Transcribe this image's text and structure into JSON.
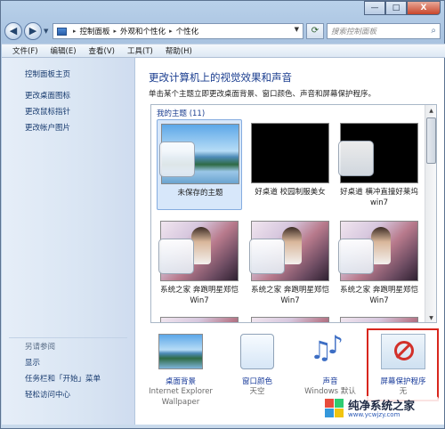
{
  "window": {
    "minimize": "—",
    "maximize": "□",
    "close": "X"
  },
  "nav": {
    "back_glyph": "◀",
    "forward_glyph": "▶",
    "dropdown_glyph": "▼",
    "breadcrumbs": [
      "控制面板",
      "外观和个性化",
      "个性化"
    ],
    "refresh_glyph": "⟳",
    "search_placeholder": "搜索控制面板",
    "search_icon": "search-icon"
  },
  "menu": [
    "文件(F)",
    "编辑(E)",
    "查看(V)",
    "工具(T)",
    "帮助(H)"
  ],
  "left_pane": {
    "links": [
      "控制面板主页",
      "更改桌面图标",
      "更改鼠标指针",
      "更改帐户图片"
    ],
    "see_also_header": "另请参阅",
    "see_also": [
      "显示",
      "任务栏和「开始」菜单",
      "轻松访问中心"
    ]
  },
  "main": {
    "heading": "更改计算机上的视觉效果和声音",
    "subtitle": "单击某个主题立即更改桌面背景、窗口颜色、声音和屏幕保护程序。",
    "group_label": "我的主题 (11)",
    "themes": [
      {
        "caption": "未保存的主题",
        "kind": "sky",
        "selected": true
      },
      {
        "caption": "好桌道 校园制服美女",
        "kind": "black",
        "selected": false
      },
      {
        "caption": "好桌道 横冲直撞好莱坞win7",
        "kind": "black",
        "selected": false
      },
      {
        "caption": "系统之家 奔跑明星郑恺Win7",
        "kind": "person",
        "selected": false
      },
      {
        "caption": "系统之家 奔跑明星郑恺Win7",
        "kind": "person",
        "selected": false
      },
      {
        "caption": "系统之家 奔跑明星郑恺Win7",
        "kind": "person",
        "selected": false
      }
    ]
  },
  "bottom": {
    "items": [
      {
        "label": "桌面背景",
        "sub": "Internet Explorer Wallpaper",
        "icon": "wallpaper-icon"
      },
      {
        "label": "窗口颜色",
        "sub": "天空",
        "icon": "window-color-icon"
      },
      {
        "label": "声音",
        "sub": "Windows 默认",
        "icon": "sound-icon"
      },
      {
        "label": "屏幕保护程序",
        "sub": "无",
        "icon": "screensaver-icon"
      }
    ]
  },
  "watermark": {
    "title": "纯净系统之家",
    "url": "www.ycwjzy.com"
  },
  "colors": {
    "link": "#173a9a",
    "heading": "#1a3d8f",
    "highlight": "#d8261d"
  }
}
